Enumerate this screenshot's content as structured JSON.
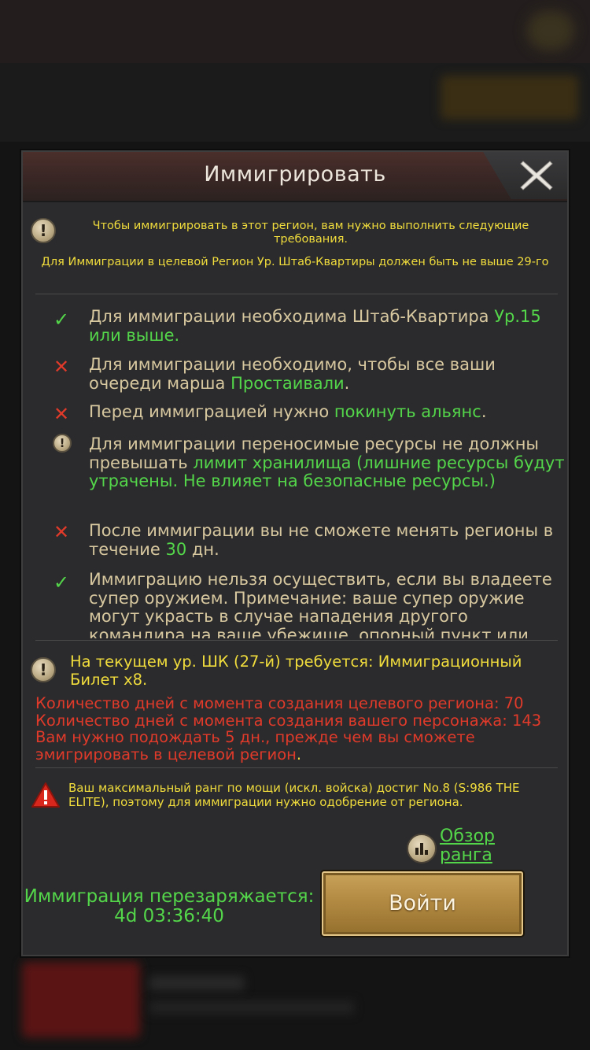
{
  "dialog": {
    "title": "Иммигрировать",
    "intro_line1": "Чтобы иммигрировать в этот регион, вам нужно выполнить следующие требования.",
    "intro_line2": "Для Иммиграции в целевой Регион Ур. Штаб-Квартиры должен быть не выше 29-го"
  },
  "requirements": [
    {
      "status": "met",
      "icon": "check-icon",
      "text": "Для иммиграции необходима Штаб-Квартира ",
      "highlight": "Ур.15 или выше",
      "suffix": "."
    },
    {
      "status": "unmet",
      "icon": "cross-icon",
      "text": "Для иммиграции необходимо, чтобы все ваши очереди марша ",
      "highlight": "Простаивали",
      "suffix": "."
    },
    {
      "status": "unmet",
      "icon": "cross-icon",
      "text": "Перед иммиграцией нужно ",
      "highlight": "покинуть альянс",
      "suffix": "."
    },
    {
      "status": "warning",
      "icon": "exclamation-icon",
      "text": "Для иммиграции переносимые ресурсы не должны превышать ",
      "highlight": "лимит хранилища (лишние ресурсы будут утрачены. Не влияет на безопасные ресурсы.)",
      "suffix": ""
    },
    {
      "status": "unmet",
      "icon": "cross-icon",
      "text": "После иммиграции вы не сможете менять регионы в течение ",
      "highlight": "30",
      "suffix": " дн."
    },
    {
      "status": "met",
      "icon": "check-icon",
      "text": "Иммиграцию нельзя осуществить, если вы владеете супер оружием. Примечание: ваше супер оружие могут украсть в случае нападения другого командира на ваше убежище, опорный пункт или",
      "highlight": "",
      "suffix": ""
    }
  ],
  "ticket": {
    "text": "На текущем ур. ШК (27-й) требуется: Иммиграционный Билет x8."
  },
  "days": {
    "text": "Количество дней с момента создания целевого региона: 70 Количество дней с момента создания вашего персонажа: 143  Вам нужно подождать 5 дн., прежде чем вы сможете эмигрировать в целевой регион",
    "suffix": "."
  },
  "warning": {
    "text": "Ваш максимальный ранг по мощи (искл. войска) достиг No.8 (S:986 THE ELITE), поэтому для иммиграции нужно одобрение от региона."
  },
  "rank_link": "Обзор ранга",
  "cooldown": "Иммиграция перезаряжается: 4d 03:36:40",
  "enter_button": "Войти",
  "colors": {
    "yellow": "#f0dc3c",
    "green": "#54d64a",
    "red": "#e03a2a",
    "beige": "#d8c8a0",
    "button_gold": "#b38a42"
  }
}
